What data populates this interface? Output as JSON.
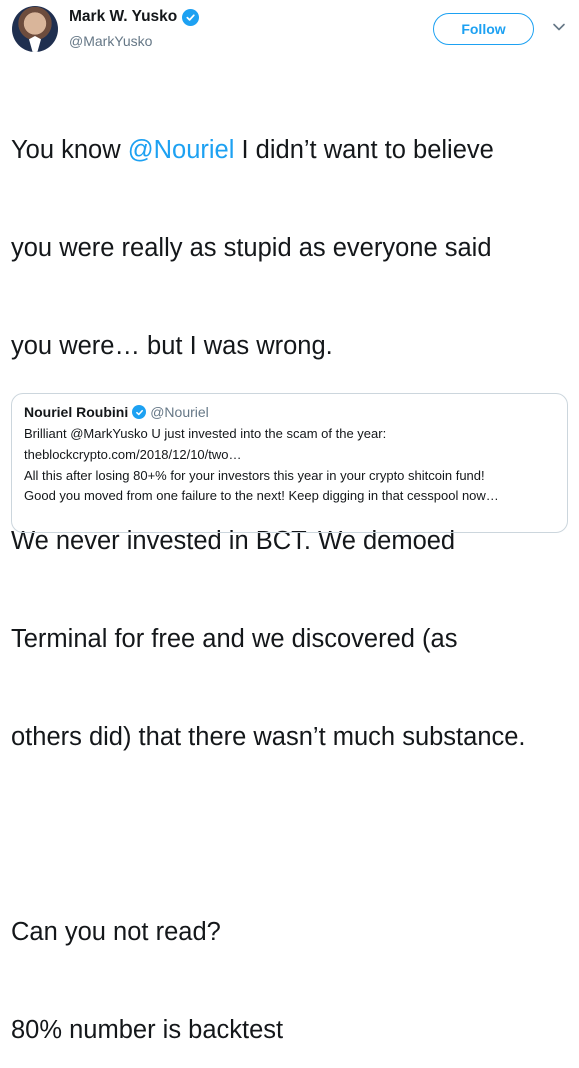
{
  "author": {
    "name": "Mark W. Yusko",
    "handle": "@MarkYusko"
  },
  "follow_label": "Follow",
  "tweet": {
    "line1_prefix": "You know ",
    "mention": "@Nouriel",
    "line1_suffix": " I didn’t want to believe",
    "lines": [
      "you were really as stupid as everyone said",
      "you were… but I was wrong.",
      "",
      "We never invested in BCT. We demoed",
      "Terminal for free and we discovered (as",
      "others did) that there wasn’t much substance.",
      "",
      "Can you not read?",
      "80% number is backtest"
    ]
  },
  "quoted": {
    "name": "Nouriel Roubini",
    "handle": "@Nouriel",
    "lines": [
      "Brilliant @MarkYusko U just invested into the scam of the year:",
      "theblockcrypto.com/2018/12/10/two…",
      "All this after losing 80+% for your investors this year in your crypto shitcoin fund!",
      "Good you moved from one failure to the next! Keep digging in that cesspool now…"
    ]
  },
  "colors": {
    "accent": "#1da1f2",
    "text": "#14171a",
    "muted": "#657786",
    "border": "#ccd6dd"
  },
  "icons": [
    "verified-icon",
    "chevron-down-icon"
  ]
}
